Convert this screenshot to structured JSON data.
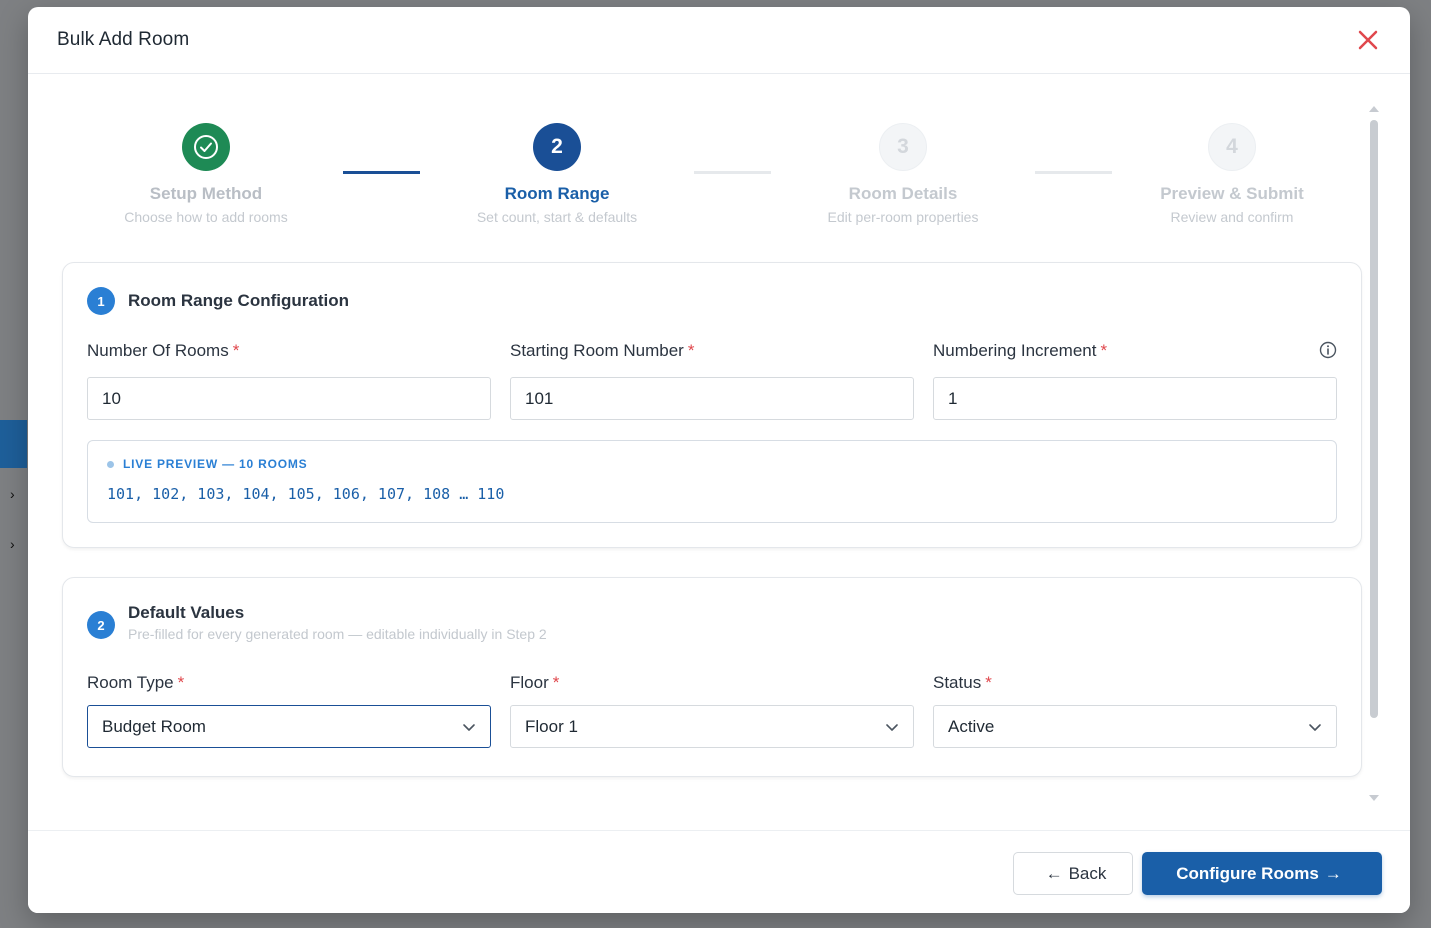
{
  "modal": {
    "title": "Bulk Add Room"
  },
  "stepper": {
    "steps": [
      {
        "number": "1",
        "label": "Setup Method",
        "sub": "Choose how to add rooms",
        "state": "done"
      },
      {
        "number": "2",
        "label": "Room Range",
        "sub": "Set count, start & defaults",
        "state": "active"
      },
      {
        "number": "3",
        "label": "Room Details",
        "sub": "Edit per-room properties",
        "state": "pending"
      },
      {
        "number": "4",
        "label": "Preview & Submit",
        "sub": "Review and confirm",
        "state": "pending"
      }
    ]
  },
  "range_card": {
    "badge": "1",
    "title": "Room Range Configuration",
    "fields": {
      "count": {
        "label": "Number Of Rooms",
        "required": "*",
        "value": "10"
      },
      "start": {
        "label": "Starting Room Number",
        "required": "*",
        "value": "101"
      },
      "increment": {
        "label": "Numbering Increment",
        "required": "*",
        "value": "1"
      }
    },
    "preview": {
      "label": "LIVE PREVIEW — 10 ROOMS",
      "values": "101, 102, 103, 104, 105, 106, 107, 108 … 110"
    }
  },
  "defaults_card": {
    "badge": "2",
    "title": "Default Values",
    "subtitle": "Pre-filled for every generated room — editable individually in Step 2",
    "fields": {
      "room_type": {
        "label": "Room Type",
        "required": "*",
        "value": "Budget Room"
      },
      "floor": {
        "label": "Floor",
        "required": "*",
        "value": "Floor 1"
      },
      "status": {
        "label": "Status",
        "required": "*",
        "value": "Active"
      }
    }
  },
  "footer": {
    "back_label": "Back",
    "back_arrow": "←",
    "primary_label": "Configure Rooms",
    "primary_arrow": "→"
  },
  "colors": {
    "primary": "#1a5fa8",
    "success": "#1e8a55",
    "required": "#e0474c",
    "close": "#e0474c"
  }
}
